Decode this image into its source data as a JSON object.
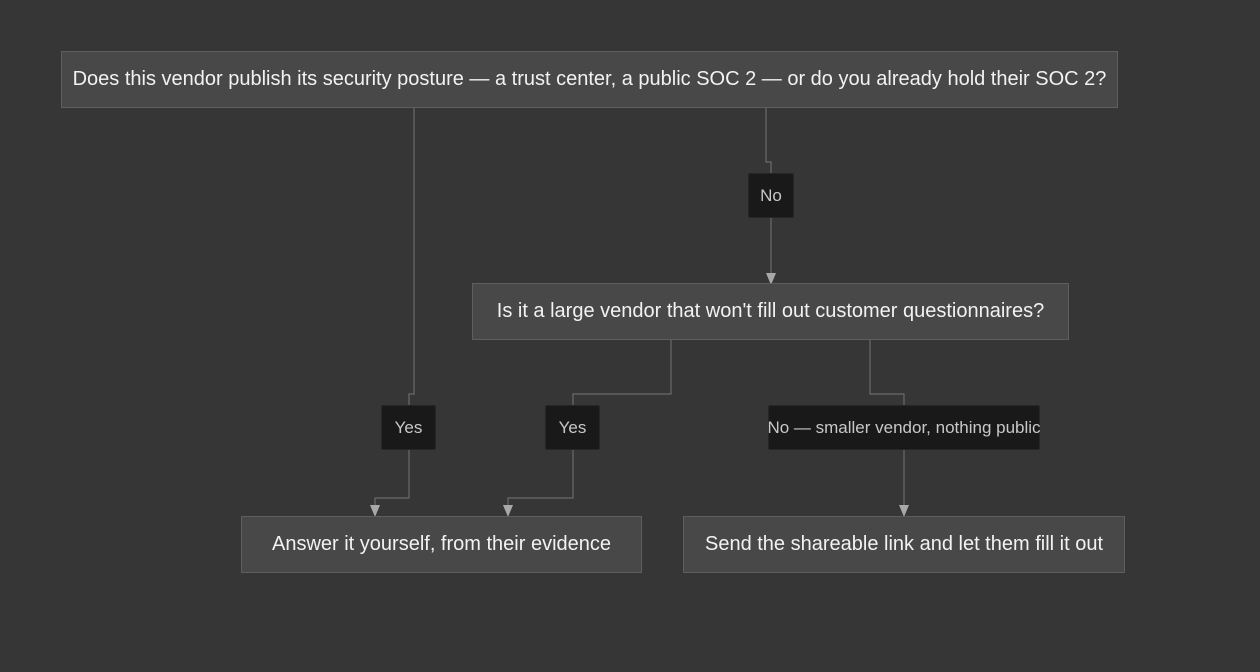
{
  "diagram": {
    "nodes": {
      "q1": "Does this vendor publish its security posture — a trust center, a public SOC 2 — or do you already hold their SOC 2?",
      "q2": "Is it a large vendor that won't fill out customer questionnaires?",
      "answer_self": "Answer it yourself, from their evidence",
      "send_link": "Send the shareable link and let them fill it out"
    },
    "edge_labels": {
      "q1_no": "No",
      "q1_yes": "Yes",
      "q2_yes": "Yes",
      "q2_no": "No — smaller vendor, nothing public"
    }
  }
}
